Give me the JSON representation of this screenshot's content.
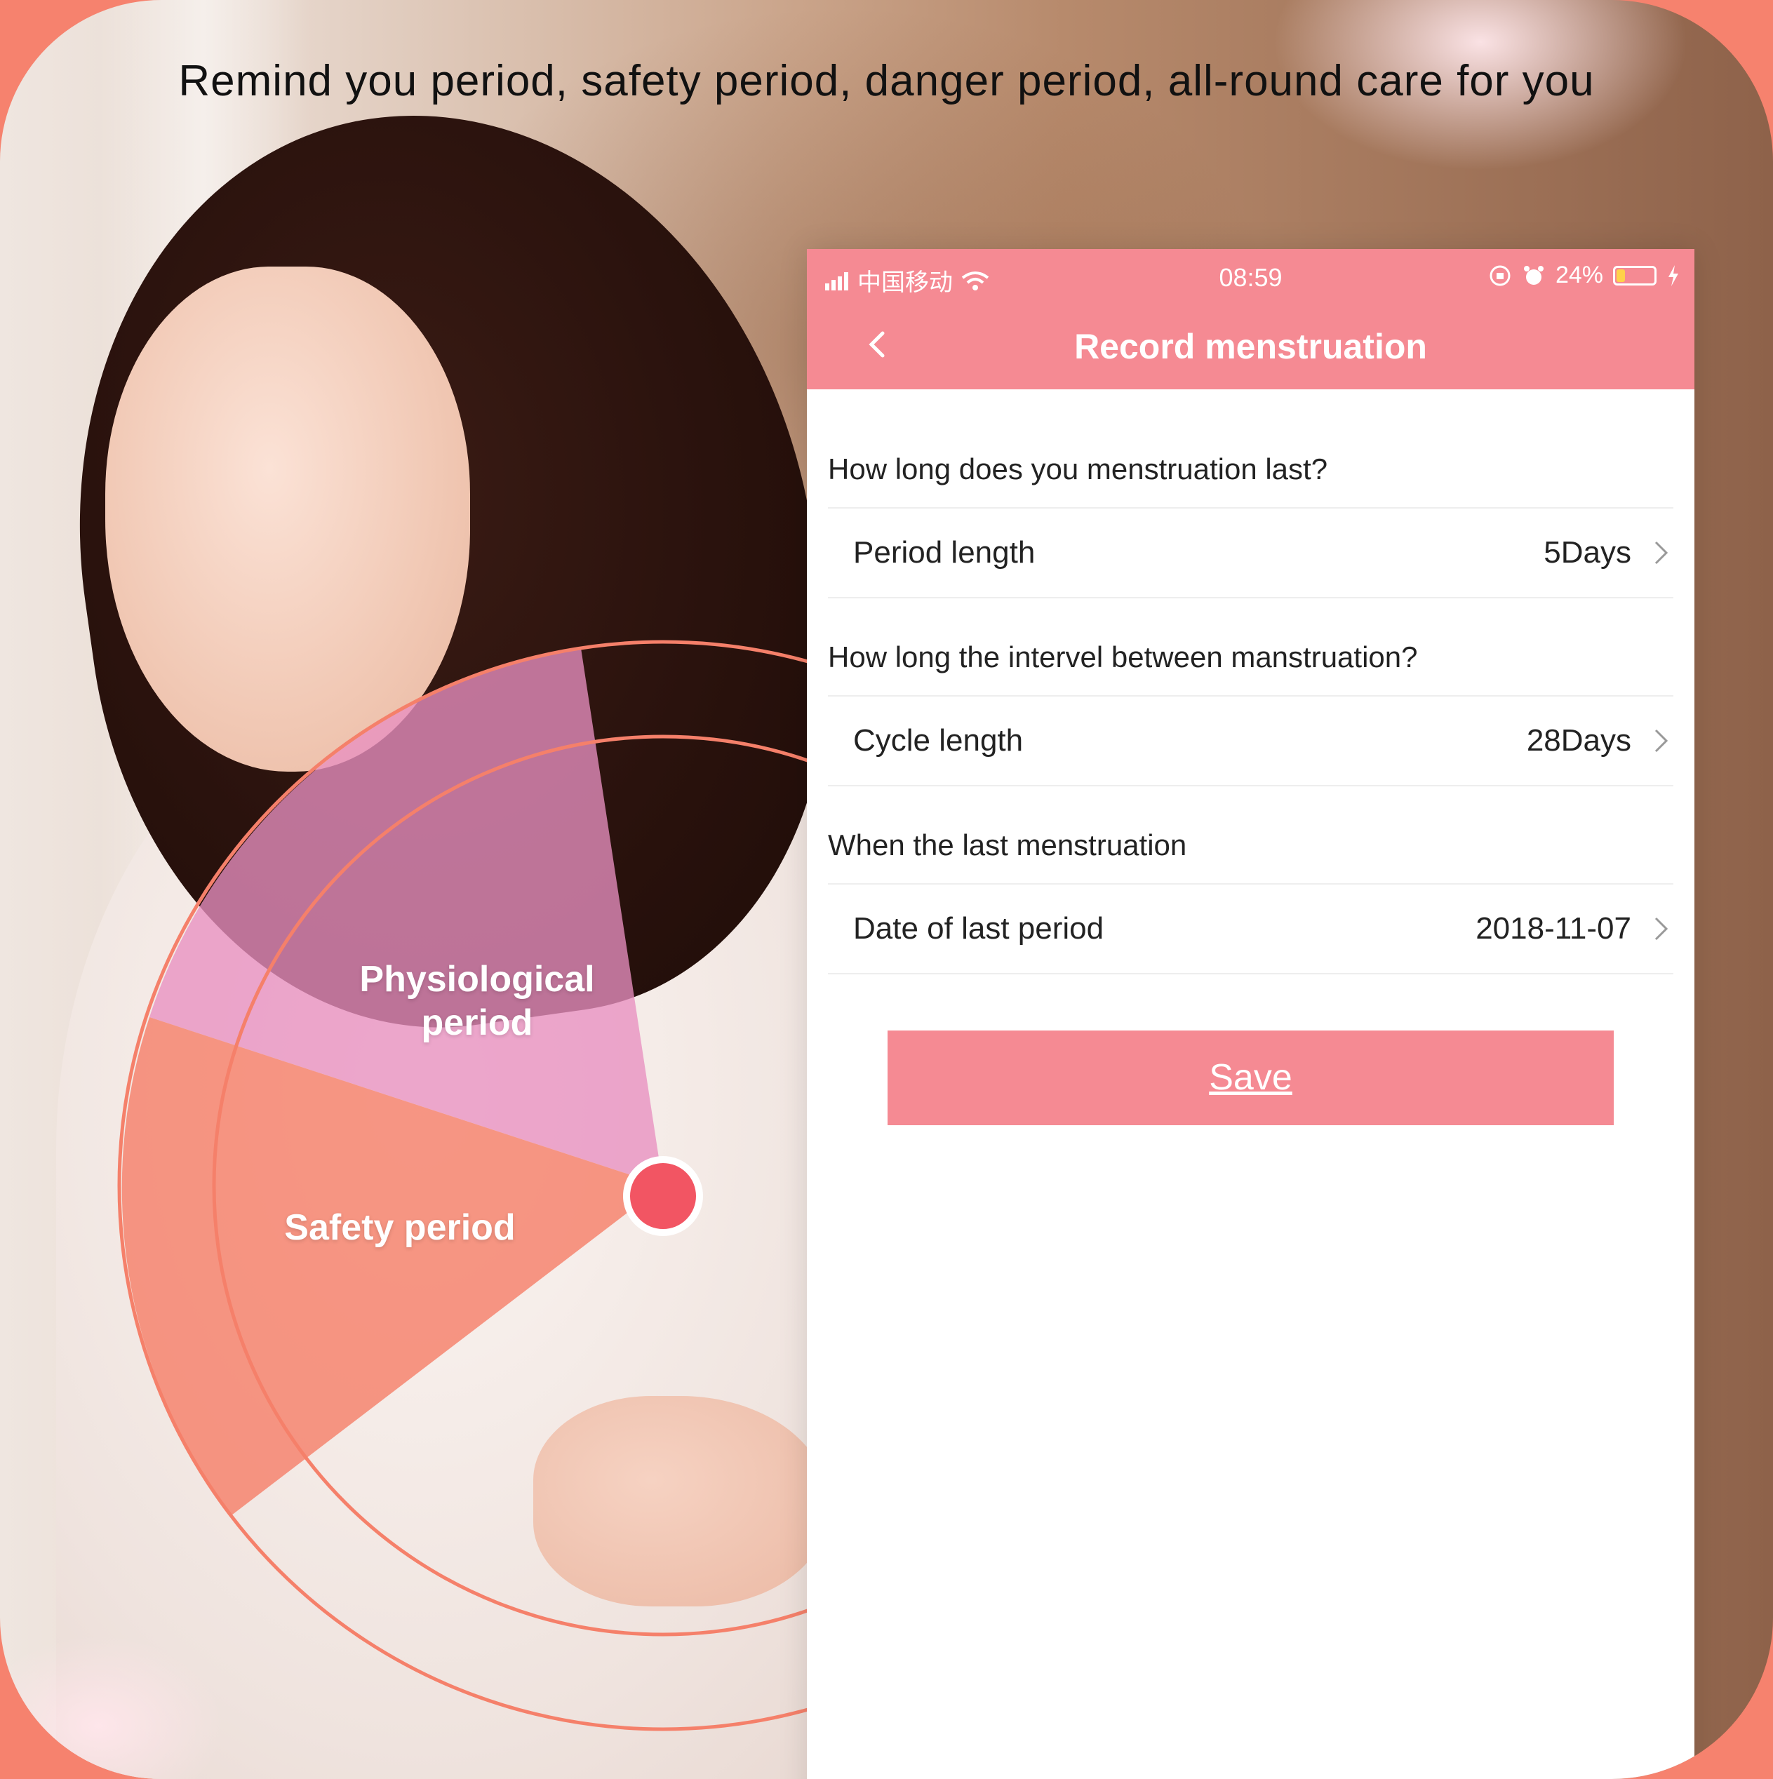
{
  "headline": "Remind you period, safety period, danger period, all-round care for you",
  "wheel": {
    "physiological_label": "Physiological period",
    "safety_label": "Safety period"
  },
  "phone": {
    "status_bar": {
      "carrier": "中国移动",
      "time": "08:59",
      "battery_percent": "24%",
      "battery_level": 0.24,
      "icons": [
        "signal-icon",
        "wifi-icon",
        "orientation-lock-icon",
        "alarm-icon",
        "battery-icon",
        "charging-icon"
      ]
    },
    "nav": {
      "title": "Record menstruation",
      "back_icon": "chevron-left-icon"
    },
    "sections": [
      {
        "question": "How long does you menstruation last?",
        "row_label": "Period length",
        "row_value": "5Days"
      },
      {
        "question": "How long the intervel between manstruation?",
        "row_label": "Cycle length",
        "row_value": "28Days"
      },
      {
        "question": "When the last menstruation",
        "row_label": "Date of last period",
        "row_value": "2018-11-07"
      }
    ],
    "save_label": "Save"
  },
  "colors": {
    "frame": "#f6826e",
    "accent": "#f58a93",
    "wheel_pink": "#e88fc0",
    "wheel_salmon": "#f5806a",
    "dot": "#f25563"
  }
}
